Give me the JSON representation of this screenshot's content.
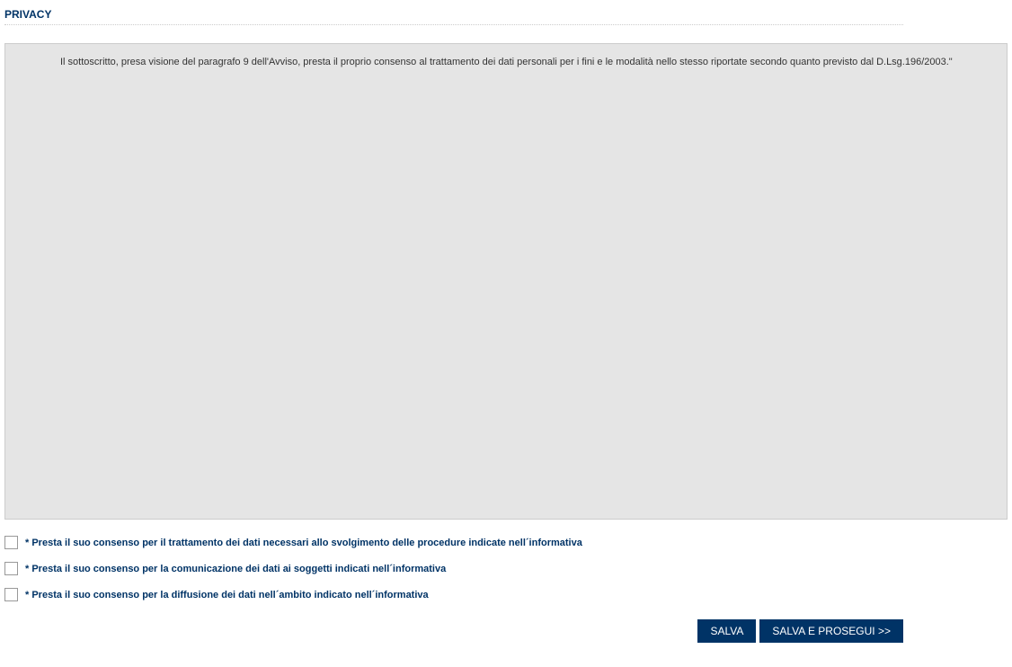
{
  "header": {
    "title": "PRIVACY"
  },
  "privacy_box": {
    "text": "Il sottoscritto, presa visione del paragrafo 9 dell'Avviso, presta il proprio consenso al trattamento dei dati personali per i fini e le modalità nello stesso riportate secondo quanto previsto dal D.Lsg.196/2003.\""
  },
  "consents": [
    {
      "label": "* Presta il suo consenso per il trattamento dei dati necessari allo svolgimento delle procedure indicate nell´informativa"
    },
    {
      "label": "* Presta il suo consenso per la comunicazione dei dati ai soggetti indicati nell´informativa"
    },
    {
      "label": "* Presta il suo consenso per la diffusione dei dati nell´ambito indicato nell´informativa"
    }
  ],
  "buttons": {
    "save": "SALVA",
    "save_continue": "SALVA E PROSEGUI >>"
  }
}
